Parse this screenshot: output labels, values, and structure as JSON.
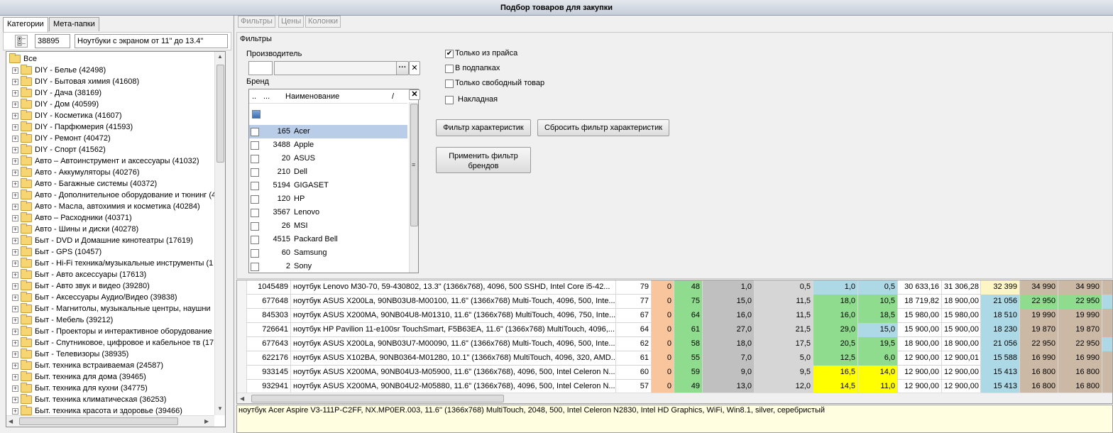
{
  "window": {
    "title": "Подбор товаров для закупки"
  },
  "left_tabs": [
    {
      "label": "Категории"
    },
    {
      "label": "Мета-папки"
    }
  ],
  "category": {
    "id": "38895",
    "name": "Ноутбуки с экраном от 11\" до 13.4\""
  },
  "tree": {
    "root": "Все",
    "items": [
      {
        "label": "DIY - Белье (42498)"
      },
      {
        "label": "DIY - Бытовая химия (41608)"
      },
      {
        "label": "DIY - Дача (38169)"
      },
      {
        "label": "DIY - Дом (40599)"
      },
      {
        "label": "DIY - Косметика (41607)"
      },
      {
        "label": "DIY - Парфюмерия (41593)"
      },
      {
        "label": "DIY - Ремонт (40472)"
      },
      {
        "label": "DIY - Спорт (41562)"
      },
      {
        "label": "Авто – Автоинструмент и аксессуары (41032)"
      },
      {
        "label": "Авто - Аккумуляторы (40276)"
      },
      {
        "label": "Авто - Багажные системы (40372)"
      },
      {
        "label": "Авто - Дополнительное оборудование и тюнинг (4"
      },
      {
        "label": "Авто - Масла, автохимия и косметика (40284)"
      },
      {
        "label": "Авто – Расходники (40371)"
      },
      {
        "label": "Авто - Шины и диски (40278)"
      },
      {
        "label": "Быт - DVD и Домашние кинотеатры (17619)"
      },
      {
        "label": "Быт - GPS (10457)"
      },
      {
        "label": "Быт - Hi-Fi техника/музыкальные инструменты (1"
      },
      {
        "label": "Быт - Авто аксессуары (17613)"
      },
      {
        "label": "Быт - Авто звук и видео (39280)"
      },
      {
        "label": "Быт - Аксессуары Аудио/Видео (39838)"
      },
      {
        "label": "Быт - Магнитолы, музыкальные центры, наушни"
      },
      {
        "label": "Быт - Мебель (39212)"
      },
      {
        "label": "Быт - Проекторы и интерактивное оборудование"
      },
      {
        "label": "Быт - Спутниковое, цифровое и кабельное тв (17"
      },
      {
        "label": "Быт - Телевизоры (38935)"
      },
      {
        "label": "Быт. техника встраиваемая (24587)"
      },
      {
        "label": "Быт. техника для дома (39465)"
      },
      {
        "label": "Быт. техника для кухни (34775)"
      },
      {
        "label": "Быт. техника климатическая (36253)"
      },
      {
        "label": "Быт. техника красота и здоровье (39466)"
      }
    ]
  },
  "right_tabs": [
    {
      "label": "Фильтры"
    },
    {
      "label": "Цены"
    },
    {
      "label": "Колонки"
    }
  ],
  "filters": {
    "group_title": "Фильтры",
    "manufacturer_label": "Производитель",
    "brand_label": "Бренд",
    "brand_columns": {
      "c1": "..",
      "c2": "...",
      "name": "Наименование",
      "sort": "/"
    },
    "brands": [
      {
        "count": "165",
        "name": "Acer"
      },
      {
        "count": "3488",
        "name": "Apple"
      },
      {
        "count": "20",
        "name": "ASUS"
      },
      {
        "count": "210",
        "name": "Dell"
      },
      {
        "count": "5194",
        "name": "GIGASET"
      },
      {
        "count": "120",
        "name": "HP"
      },
      {
        "count": "3567",
        "name": "Lenovo"
      },
      {
        "count": "26",
        "name": "MSI"
      },
      {
        "count": "4515",
        "name": "Packard Bell"
      },
      {
        "count": "60",
        "name": "Samsung"
      },
      {
        "count": "2",
        "name": "Sony"
      }
    ],
    "options": [
      {
        "label": "Только из прайса",
        "checked": true
      },
      {
        "label": "В подпапках",
        "checked": false
      },
      {
        "label": "Только свободный товар",
        "checked": false
      },
      {
        "label": "Накладная",
        "checked": false
      }
    ],
    "buttons": {
      "char_filter": "Фильтр характеристик",
      "reset_char": "Сбросить фильтр характеристик",
      "apply_brand": "Применить фильтр брендов"
    }
  },
  "grid_rows": [
    [
      "1045489",
      "ноутбук Lenovo M30-70, 59-430802, 13.3\" (1366x768), 4096, 500 SSHD, Intel Core i5-42...",
      "79",
      "0",
      "48",
      "1,0",
      "0,5",
      "1,0",
      "0,5",
      "30 633,16",
      "31 306,28",
      "32 399",
      "34 990",
      "34 990"
    ],
    [
      "677648",
      "ноутбук ASUS X200La, 90NB03U8-M00100, 11.6\" (1366x768) Multi-Touch, 4096, 500, Inte...",
      "77",
      "0",
      "75",
      "15,0",
      "11,5",
      "18,0",
      "10,5",
      "18 719,82",
      "18 900,00",
      "21 056",
      "22 950",
      "22 950"
    ],
    [
      "845303",
      "ноутбук ASUS X200MA, 90NB04U8-M01310, 11.6\" (1366x768) MultiTouch, 4096, 750, Inte...",
      "67",
      "0",
      "64",
      "16,0",
      "11,5",
      "16,0",
      "18,5",
      "15 980,00",
      "15 980,00",
      "18 510",
      "19 990",
      "19 990"
    ],
    [
      "726641",
      "ноутбук HP Pavilion 11-e100sr TouchSmart, F5B63EA, 11.6\" (1366x768) MultiTouch, 4096,...",
      "64",
      "0",
      "61",
      "27,0",
      "21,5",
      "29,0",
      "15,0",
      "15 900,00",
      "15 900,00",
      "18 230",
      "19 870",
      "19 870"
    ],
    [
      "677643",
      "ноутбук ASUS X200La, 90NB03U7-M00090, 11.6\" (1366x768) Multi-Touch, 4096, 500, Inte...",
      "62",
      "0",
      "58",
      "18,0",
      "17,5",
      "20,5",
      "19,5",
      "18 900,00",
      "18 900,00",
      "21 056",
      "22 950",
      "22 950"
    ],
    [
      "622176",
      "ноутбук ASUS X102BA, 90NB0364-M01280, 10.1\" (1366x768) MultiTouch, 4096, 320, AMD...",
      "61",
      "0",
      "55",
      "7,0",
      "5,0",
      "12,5",
      "6,0",
      "12 900,00",
      "12 900,01",
      "15 588",
      "16 990",
      "16 990"
    ],
    [
      "933145",
      "ноутбук ASUS X200MA, 90NB04U3-M05900, 11.6\" (1366x768), 4096, 500, Intel Celeron N...",
      "60",
      "0",
      "59",
      "9,0",
      "9,5",
      "16,5",
      "14,0",
      "12 900,00",
      "12 900,00",
      "15 413",
      "16 800",
      "16 800"
    ],
    [
      "932941",
      "ноутбук ASUS X200MA, 90NB04U2-M05880, 11.6\" (1366x768), 4096, 500, Intel Celeron N...",
      "57",
      "0",
      "49",
      "13,0",
      "12,0",
      "14,5",
      "11,0",
      "12 900,00",
      "12 900,00",
      "15 413",
      "16 800",
      "16 800"
    ]
  ],
  "description": "ноутбук Acer Aspire V3-111P-C2FF, NX.MP0ER.003, 11.6'' (1366x768) MultiTouch, 2048, 500, Intel Celeron N2830, Intel HD Graphics, WiFi, Win8.1, silver, серебристый",
  "colors": {
    "orange": "#f8c59d",
    "green": "#8fdc8f",
    "gray": "#c0c0c0",
    "lightgray": "#d6d6d6",
    "blue": "#add8e6",
    "yellow": "#ffff00",
    "cream": "#fdf5c4",
    "tan": "#cbb8a5"
  }
}
